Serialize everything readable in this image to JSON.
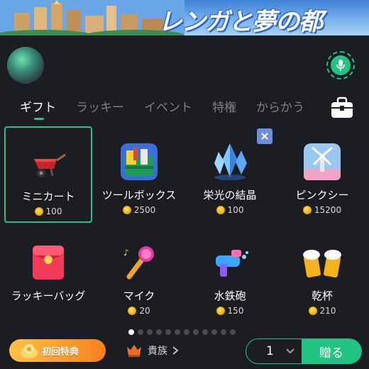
{
  "banner": {
    "title": "レンガと夢の都"
  },
  "tabs": [
    {
      "label": "ギフト",
      "active": true
    },
    {
      "label": "ラッキー",
      "active": false
    },
    {
      "label": "イベント",
      "active": false
    },
    {
      "label": "特権",
      "active": false
    },
    {
      "label": "からかう",
      "active": false
    }
  ],
  "gifts": [
    {
      "name": "ミニカート",
      "price": "100",
      "icon": "wheelbarrow-icon",
      "selected": true
    },
    {
      "name": "ツールボックス",
      "price": "2500",
      "icon": "toolbox-icon",
      "selected": false
    },
    {
      "name": "栄光の結晶",
      "price": "100",
      "icon": "crystal-icon",
      "selected": false
    },
    {
      "name": "ピンクシー",
      "price": "15200",
      "icon": "windmill-icon",
      "selected": false
    },
    {
      "name": "ラッキーバッグ",
      "price": "",
      "icon": "red-envelope-icon",
      "selected": false
    },
    {
      "name": "マイク",
      "price": "20",
      "icon": "microphone-icon",
      "selected": false
    },
    {
      "name": "水鉄砲",
      "price": "150",
      "icon": "water-gun-icon",
      "selected": false
    },
    {
      "name": "乾杯",
      "price": "210",
      "icon": "beer-cheers-icon",
      "selected": false
    }
  ],
  "pager": {
    "total": 12,
    "active": 0
  },
  "bottom": {
    "first_gift_label": "初回特典",
    "noble_label": "貴族",
    "quantity": "1",
    "send_label": "贈る"
  },
  "colors": {
    "accent": "#22c486",
    "background": "#1c1d23",
    "coin": "#f1b200"
  }
}
